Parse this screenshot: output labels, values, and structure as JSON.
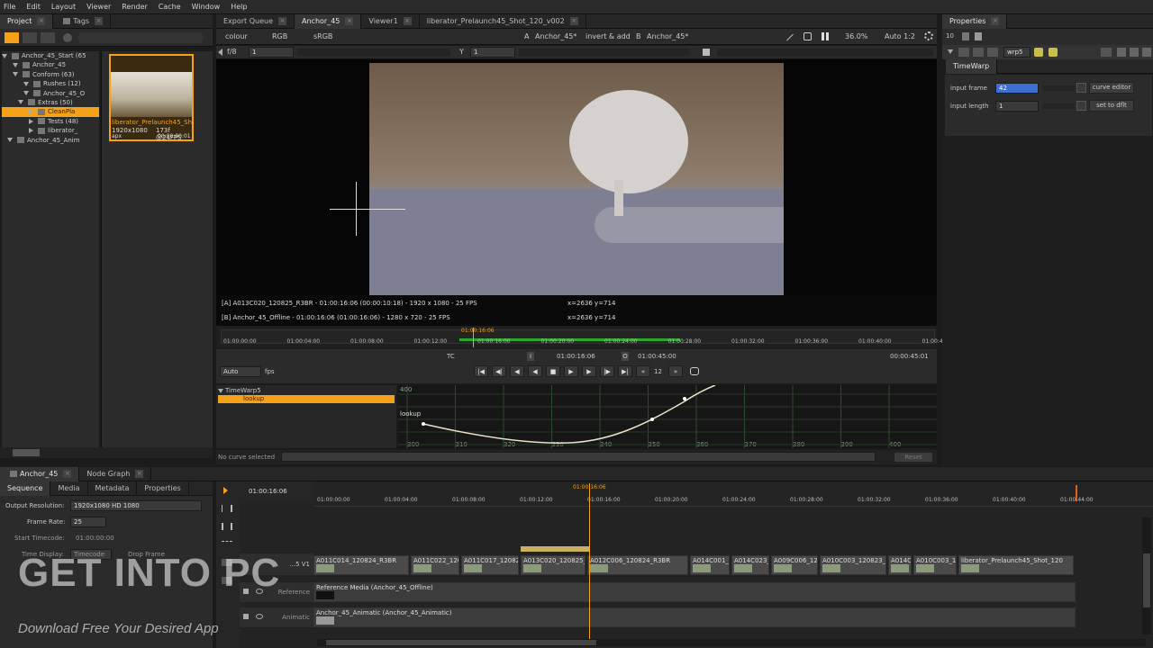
{
  "menu": [
    "File",
    "Edit",
    "Layout",
    "Viewer",
    "Render",
    "Cache",
    "Window",
    "Help"
  ],
  "left_tabs": [
    "Project",
    "Tags"
  ],
  "tree": [
    {
      "label": "Anchor_45_Start (65",
      "indent": 0,
      "sel": false
    },
    {
      "label": "Anchor_45",
      "indent": 2,
      "sel": false
    },
    {
      "label": "Conform (63)",
      "indent": 2,
      "sel": false
    },
    {
      "label": "Rushes (12)",
      "indent": 4,
      "sel": false
    },
    {
      "label": "Anchor_45_O",
      "indent": 4,
      "sel": false
    },
    {
      "label": "Extras (50)",
      "indent": 3,
      "sel": false
    },
    {
      "label": "CleanPla",
      "indent": 5,
      "sel": true
    },
    {
      "label": "Tests (48)",
      "indent": 5,
      "sel": false
    },
    {
      "label": "liberator_",
      "indent": 5,
      "sel": false
    },
    {
      "label": "Anchor_45_Anim",
      "indent": 1,
      "sel": false
    }
  ],
  "thumb": {
    "name": "liberator_Prelaunch45_Sh",
    "res": "1920x1080",
    "fps": "173f @24FPS",
    "tc": "00:00:00:01",
    "extra": "apx"
  },
  "viewer_tabs": [
    "Export Queue",
    "Anchor_45",
    "Viewer1",
    "liberator_Prelaunch45_Shot_120_v002"
  ],
  "viewer_toolbar": {
    "colour": "colour",
    "space": "RGB",
    "lut": "sRGB",
    "a_label": "A",
    "a_value": "Anchor_45*",
    "blend": "invert & add",
    "b_label": "B",
    "b_value": "Anchor_45*",
    "zoom": "36.0%",
    "scale": "Auto 1:2"
  },
  "viewer_toolbar2": {
    "fstop": "f/8",
    "frame": "1",
    "y_label": "Y",
    "y_value": "1"
  },
  "info": {
    "a_line": "[A] A013C020_120825_R3BR - 01:00:16:06 (00:00:10:18) - 1920 x 1080 - 25 FPS",
    "a_coord": "x=2636 y=714",
    "b_line": "[B] Anchor_45_Offline - 01:00:16:06 (01:00:16:06) - 1280 x 720 - 25 FPS",
    "b_coord": "x=2636 y=714"
  },
  "timebar": {
    "current": "01:00:16:06",
    "ticks": [
      "01:00:00:00",
      "01:00:04:00",
      "01:00:08:00",
      "01:00:12:00",
      "01:00:16:00",
      "01:00:20:00",
      "01:00:24:00",
      "01:00:28:00",
      "01:00:32:00",
      "01:00:36:00",
      "01:00:40:00",
      "01:00:4"
    ]
  },
  "transport": {
    "tc": "TC",
    "current": "01:00:16:06",
    "in_marker": "I",
    "out_time": "01:00:45:00",
    "out_marker": "O",
    "end": "00:00:45:01",
    "step": "12",
    "auto": "Auto",
    "fps": "fps"
  },
  "curve": {
    "node": "TimeWarp5",
    "param": "lookup",
    "label": "lookup",
    "status": "No curve selected",
    "xticks": [
      "300",
      "310",
      "320",
      "330",
      "340",
      "350",
      "360",
      "370",
      "380",
      "390",
      "400"
    ],
    "ytick": "400",
    "reset": "Reset"
  },
  "properties": {
    "tab": "Properties",
    "count": "10",
    "node_name": "wrp5",
    "node_tab": "TimeWarp",
    "input_frame_label": "input frame",
    "input_frame_value": "42",
    "input_length_label": "input length",
    "input_length_value": "1",
    "curve_editor": "curve editor",
    "set_to": "set to dflt"
  },
  "bottom_tabs": [
    "Anchor_45",
    "Node Graph"
  ],
  "seq_tabs": [
    "Sequence",
    "Media",
    "Metadata",
    "Properties"
  ],
  "sequence": {
    "out_res_label": "Output Resolution:",
    "out_res": "1920x1080 HD 1080",
    "frame_rate_label": "Frame Rate:",
    "frame_rate": "25",
    "start_tc_label": "Start Timecode:",
    "start_tc": "01:00:00:00",
    "time_disp_label": "Time Display:",
    "time_disp": "Timecode",
    "drop_frame": "Drop Frame"
  },
  "timeline": {
    "current": "01:00:16:06",
    "playhead": "01:00:16:06",
    "ticks": [
      "01:00:00:00",
      "01:00:04:00",
      "01:00:08:00",
      "01:00:12:00",
      "01:00:16:00",
      "01:00:20:00",
      "01:00:24:00",
      "01:00:28:00",
      "01:00:32:00",
      "01:00:36:00",
      "01:00:40:00",
      "01:00:44:00"
    ],
    "tracks": [
      {
        "label": "...5 V1"
      },
      {
        "label": "Reference"
      },
      {
        "label": "Animatic"
      }
    ],
    "v1_clips": [
      "A011C014_120824_R3BR",
      "A011C022_120",
      "A011C017_120824",
      "A013C020_120825_R3",
      "A012C006_120824_R3BR",
      "A014C001_1",
      "A014C023_1",
      "A009C006_120",
      "A010C003_120823_R",
      "A014C0",
      "A010C003_12",
      "liberator_Prelaunch45_Shot_120"
    ],
    "ref_clip": "Reference Media (Anchor_45_Offline)",
    "anim_clip": "Anchor_45_Animatic (Anchor_45_Animatic)"
  },
  "watermark": {
    "main": "GET INTO PC",
    "sub": "Download Free Your Desired App"
  }
}
